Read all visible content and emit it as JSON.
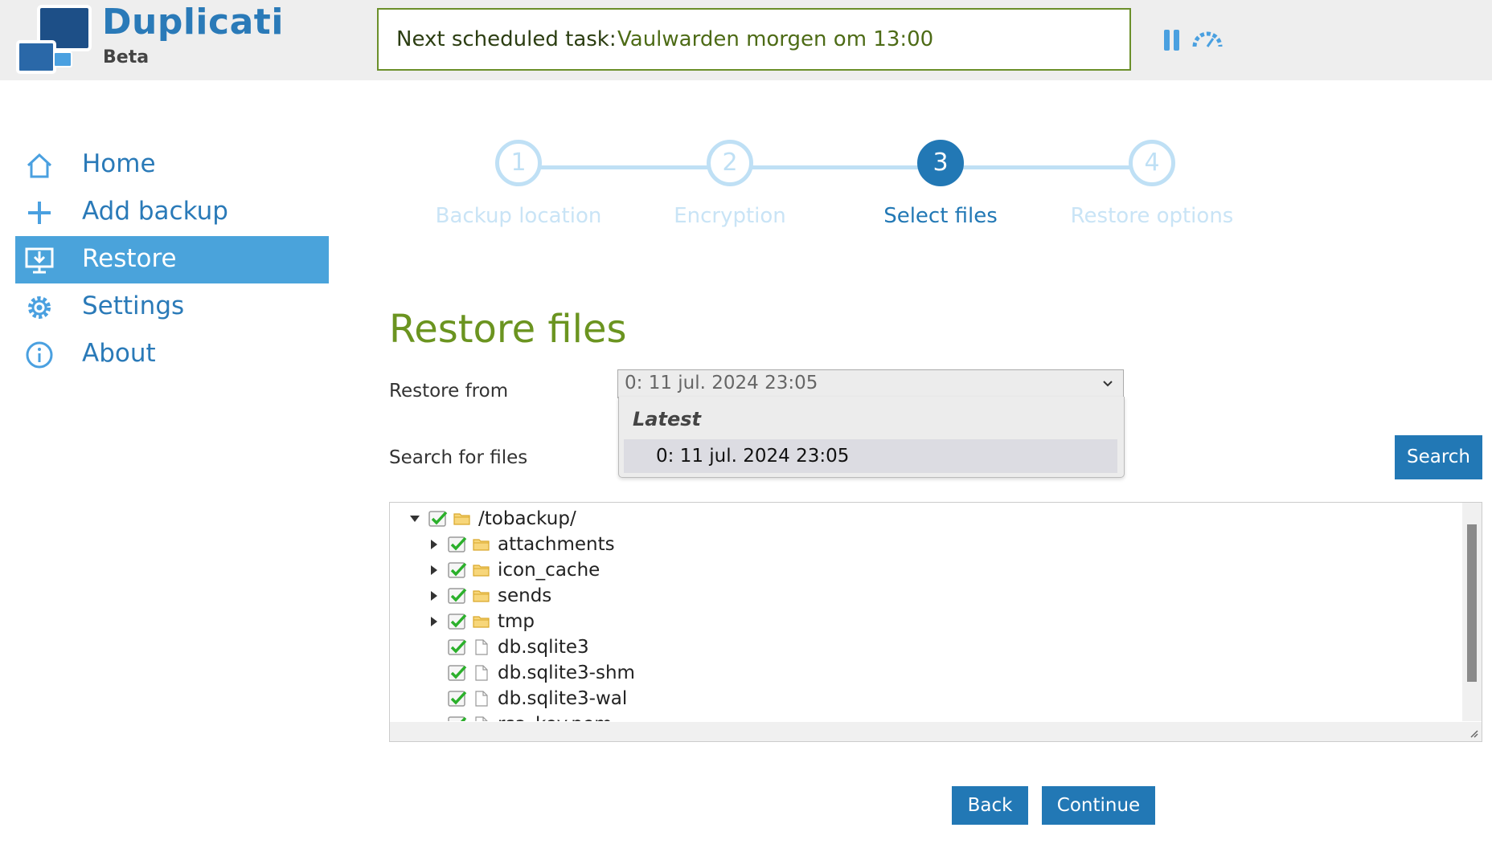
{
  "app": {
    "title": "Duplicati",
    "subtitle": "Beta"
  },
  "task": {
    "label": "Next scheduled task:",
    "value": "Vaulwarden morgen om 13:00"
  },
  "sidebar": {
    "items": [
      {
        "label": "Home",
        "icon": "home-icon"
      },
      {
        "label": "Add backup",
        "icon": "plus-icon"
      },
      {
        "label": "Restore",
        "icon": "restore-icon",
        "active": true
      },
      {
        "label": "Settings",
        "icon": "gear-icon"
      },
      {
        "label": "About",
        "icon": "info-icon"
      }
    ]
  },
  "stepper": {
    "steps": [
      {
        "number": "1",
        "label": "Backup location"
      },
      {
        "number": "2",
        "label": "Encryption"
      },
      {
        "number": "3",
        "label": "Select files",
        "active": true
      },
      {
        "number": "4",
        "label": "Restore options"
      }
    ]
  },
  "main": {
    "title": "Restore files",
    "restore_from_label": "Restore from",
    "restore_from_value": "0: 11 jul. 2024 23:05",
    "dropdown": {
      "group": "Latest",
      "option": "0: 11 jul. 2024 23:05"
    },
    "search_label": "Search for files",
    "search_button": "Search",
    "tree": [
      {
        "label": "/tobackup/",
        "type": "folder",
        "expanded": true,
        "checked": true
      },
      {
        "label": "attachments",
        "type": "folder",
        "checked": true
      },
      {
        "label": "icon_cache",
        "type": "folder",
        "checked": true
      },
      {
        "label": "sends",
        "type": "folder",
        "checked": true
      },
      {
        "label": "tmp",
        "type": "folder",
        "checked": true
      },
      {
        "label": "db.sqlite3",
        "type": "file",
        "checked": true
      },
      {
        "label": "db.sqlite3-shm",
        "type": "file",
        "checked": true
      },
      {
        "label": "db.sqlite3-wal",
        "type": "file",
        "checked": true
      },
      {
        "label": "rsa_key.pem",
        "type": "file",
        "checked": true
      }
    ],
    "back_button": "Back",
    "continue_button": "Continue"
  },
  "colors": {
    "accent": "#2278b5",
    "active_nav": "#4aa3db",
    "title_green": "#6b9420"
  }
}
